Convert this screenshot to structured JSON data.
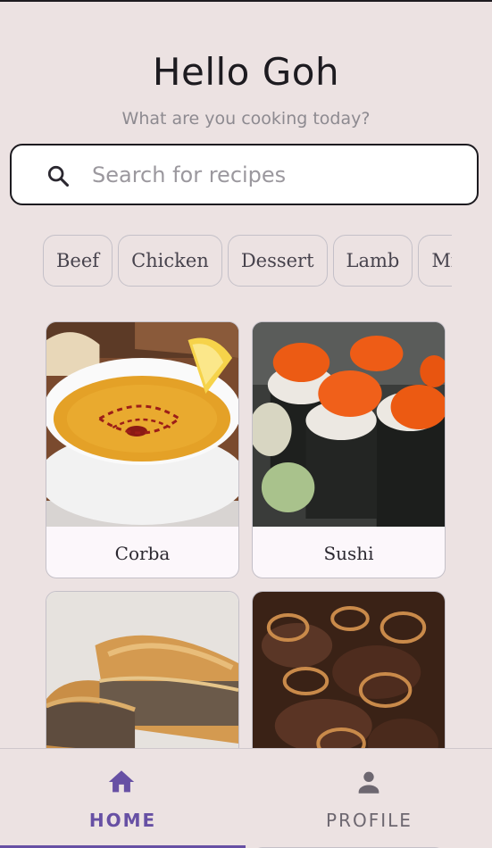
{
  "header": {
    "greeting": "Hello Goh",
    "subtitle": "What are you cooking today?"
  },
  "search": {
    "placeholder": "Search for recipes",
    "value": "",
    "icon": "search-icon"
  },
  "categories": [
    "Beef",
    "Chicken",
    "Dessert",
    "Lamb",
    "Miscellaneous"
  ],
  "recipes": [
    {
      "name": "Corba"
    },
    {
      "name": "Sushi"
    },
    {
      "name": ""
    },
    {
      "name": ""
    }
  ],
  "nav": {
    "home_label": "HOME",
    "profile_label": "PROFILE",
    "home_icon": "home-icon",
    "profile_icon": "person-icon",
    "active": "home",
    "accent_color": "#6750a4",
    "inactive_color": "#6d6770"
  },
  "colors": {
    "background": "#ece2e2",
    "card_background": "#fcf7fb",
    "text_primary": "#1d1b20",
    "text_secondary": "#8d8a90"
  }
}
